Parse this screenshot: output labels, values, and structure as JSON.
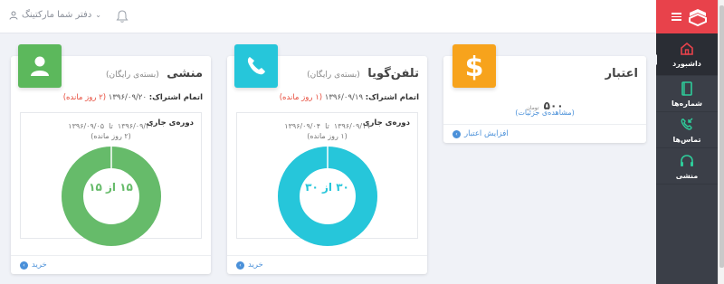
{
  "topbar": {
    "office_label": "دفتر شما مارکتینگ"
  },
  "sidebar": {
    "items": [
      {
        "label": "داشبورد",
        "icon": "home-icon",
        "active": true
      },
      {
        "label": "شماره‌ها",
        "icon": "book-icon"
      },
      {
        "label": "تماس‌ها",
        "icon": "phone-incoming-icon"
      },
      {
        "label": "منشی",
        "icon": "headset-icon"
      }
    ]
  },
  "credit": {
    "title": "اعتبار",
    "amount": "۵۰۰",
    "unit": "تومان",
    "details_link": "(مشاهده‌ی جزئیات)",
    "increase_link": "افزایش اعتبار",
    "color": "#f39c12"
  },
  "phone": {
    "title": "تلفن‌گویا",
    "subtitle": "(بسته‌ی رایگان)",
    "expire_label": "اتمام اشتراک:",
    "expire_date": "۱۳۹۶/۰۹/۱۹",
    "expire_remaining": "(۱ روز مانده)",
    "period_title": "دوره‌ی جاری",
    "period_from": "۱۳۹۶/۰۹/۰۴",
    "period_to_word": "تا",
    "period_to": "۱۳۹۶/۰۹/۱۹",
    "period_remaining": "(۱ روز مانده)",
    "usage_label": "۳۰ از ۳۰",
    "used": 30,
    "total": 30,
    "buy_link": "خرید",
    "color": "#26c6da"
  },
  "secretary": {
    "title": "منشی",
    "subtitle": "(بسته‌ی رایگان)",
    "expire_label": "اتمام اشتراک:",
    "expire_date": "۱۳۹۶/۰۹/۲۰",
    "expire_remaining": "(۲ روز مانده)",
    "period_title": "دوره‌ی جاری",
    "period_from": "۱۳۹۶/۰۹/۰۵",
    "period_to_word": "تا",
    "period_to": "۱۳۹۶/۰۹/۲۰",
    "period_remaining": "(۲ روز مانده)",
    "usage_label": "۱۵ از ۱۵",
    "used": 15,
    "total": 15,
    "buy_link": "خرید",
    "color": "#66bb6a"
  }
}
